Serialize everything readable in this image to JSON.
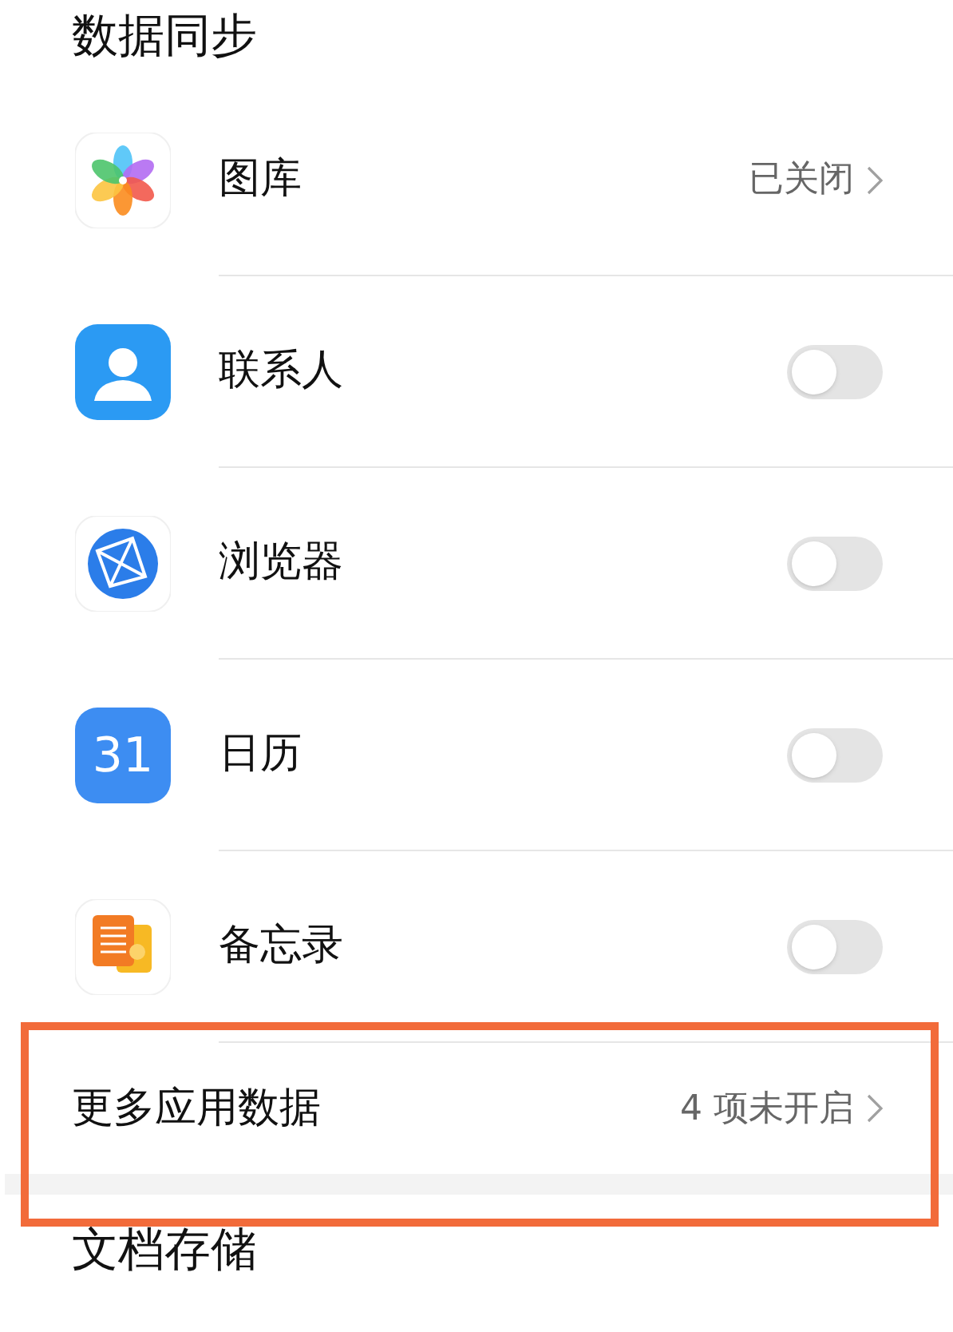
{
  "sections": [
    {
      "title": "数据同步",
      "items": [
        {
          "kind": "value",
          "label": "图库",
          "value": "已关闭"
        },
        {
          "kind": "toggle",
          "label": "联系人",
          "on": false
        },
        {
          "kind": "toggle",
          "label": "浏览器",
          "on": false
        },
        {
          "kind": "toggle",
          "icon_text": "31",
          "label": "日历",
          "on": false
        },
        {
          "kind": "toggle",
          "label": "备忘录",
          "on": false
        }
      ],
      "more": {
        "label": "更多应用数据",
        "value": "4 项未开启",
        "highlighted": true
      }
    },
    {
      "title": "文档存储"
    }
  ]
}
